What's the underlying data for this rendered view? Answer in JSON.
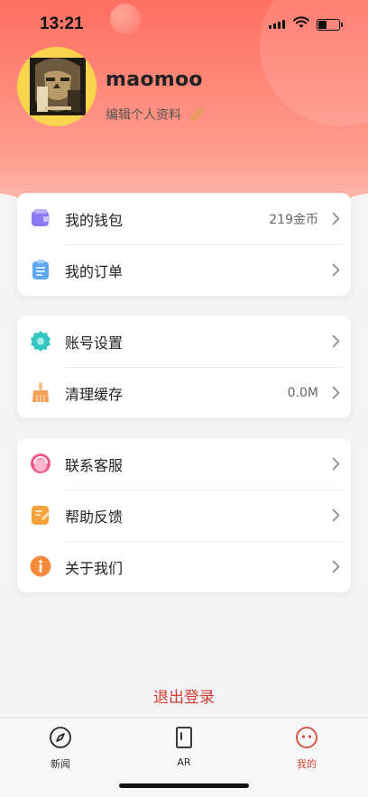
{
  "status_bar": {
    "time": "13:21",
    "battery_level": 0.45
  },
  "profile": {
    "username": "maomoo",
    "edit_label": "编辑个人资料"
  },
  "sections": [
    {
      "items": [
        {
          "label": "我的钱包",
          "value": "219金币",
          "icon": "wallet-icon",
          "color": "#8b7cf6"
        },
        {
          "label": "我的订单",
          "value": "",
          "icon": "order-icon",
          "color": "#5fa8f5"
        }
      ]
    },
    {
      "items": [
        {
          "label": "账号设置",
          "value": "",
          "icon": "settings-gear-icon",
          "color": "#35c7c4"
        },
        {
          "label": "清理缓存",
          "value": "0.0M",
          "icon": "broom-icon",
          "color": "#f5a05a"
        }
      ]
    },
    {
      "items": [
        {
          "label": "联系客服",
          "value": "",
          "icon": "customer-service-icon",
          "color": "#f0578a"
        },
        {
          "label": "帮助反馈",
          "value": "",
          "icon": "feedback-icon",
          "color": "#f6a33b"
        },
        {
          "label": "关于我们",
          "value": "",
          "icon": "info-icon",
          "color": "#f58b3b"
        }
      ]
    }
  ],
  "logout_label": "退出登录",
  "tabs": [
    {
      "label": "新闻",
      "icon": "compass-icon",
      "active": false
    },
    {
      "label": "AR",
      "icon": "ar-door-icon",
      "active": false
    },
    {
      "label": "我的",
      "icon": "smiley-face-icon",
      "active": true
    }
  ],
  "colors": {
    "accent": "#d24a3a",
    "header_gradient_top": "#ff6f61"
  }
}
